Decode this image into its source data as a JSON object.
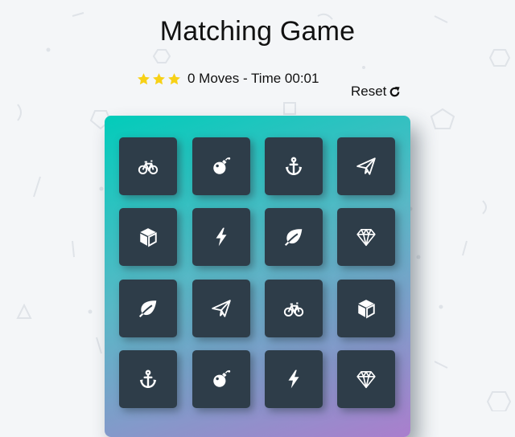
{
  "title": "Matching Game",
  "score": {
    "stars_filled": 3,
    "stars_total": 3,
    "moves_text": "0 Moves - Time 00:01"
  },
  "reset": {
    "label": "Reset",
    "icon": "redo-icon"
  },
  "colors": {
    "card_back": "#2e3d49",
    "deck_gradient_start": "#02ccba",
    "deck_gradient_end": "#aa7ecd",
    "star": "#f7d117"
  },
  "deck": {
    "cards": [
      {
        "icon": "bicycle"
      },
      {
        "icon": "bomb"
      },
      {
        "icon": "anchor"
      },
      {
        "icon": "paper-plane"
      },
      {
        "icon": "cube"
      },
      {
        "icon": "bolt"
      },
      {
        "icon": "leaf"
      },
      {
        "icon": "diamond"
      },
      {
        "icon": "leaf"
      },
      {
        "icon": "paper-plane"
      },
      {
        "icon": "bicycle"
      },
      {
        "icon": "cube"
      },
      {
        "icon": "anchor"
      },
      {
        "icon": "bomb"
      },
      {
        "icon": "bolt"
      },
      {
        "icon": "diamond"
      }
    ]
  }
}
